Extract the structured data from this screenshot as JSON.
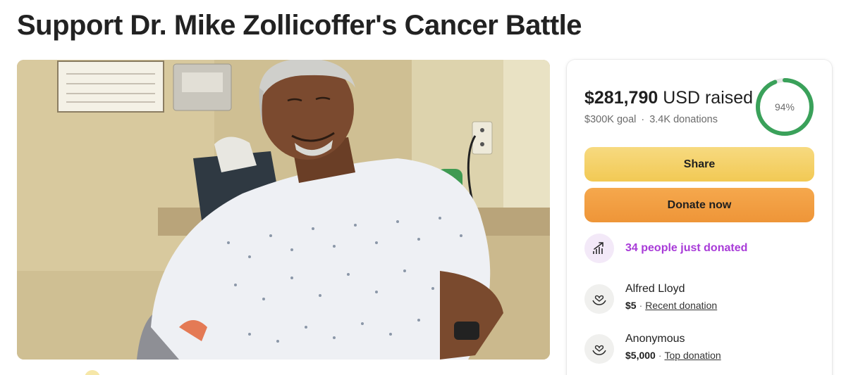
{
  "page": {
    "title": "Support Dr. Mike Zollicoffer's Cancer Battle"
  },
  "campaign": {
    "amount": "$281,790",
    "currency_label": "USD raised",
    "goal": "$300K goal",
    "separator": "·",
    "donations": "3.4K donations",
    "progress_percent": 94,
    "progress_label": "94%"
  },
  "buttons": {
    "share_label": "Share",
    "donate_label": "Donate now"
  },
  "activity": {
    "trend_text": "34 people just donated",
    "trend_icon": "trend-arrow-icon"
  },
  "donations": [
    {
      "name": "Alfred Lloyd",
      "amount": "$5",
      "tag": "Recent donation",
      "icon": "heart-hands-icon"
    },
    {
      "name": "Anonymous",
      "amount": "$5,000",
      "tag": "Top donation",
      "icon": "heart-hands-icon"
    }
  ],
  "colors": {
    "progress_ring": "#3aa15a",
    "progress_track": "#e6e6e6",
    "share_button": "#f2c954",
    "donate_button": "#ee9538",
    "trend_text": "#a83bd8"
  }
}
